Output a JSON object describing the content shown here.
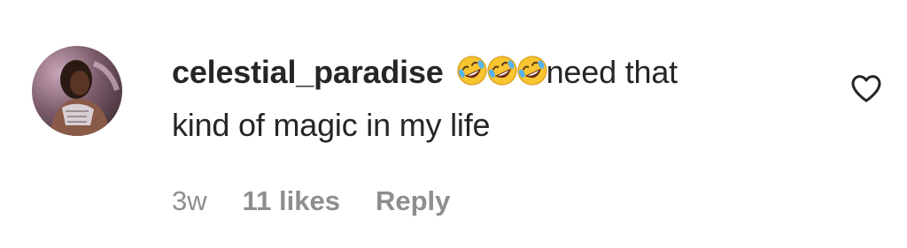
{
  "comment": {
    "avatar_icon": "user-avatar-photo",
    "username": "celestial_paradise",
    "emojis": [
      "rolling-on-floor-laughing-emoji",
      "rolling-on-floor-laughing-emoji",
      "rolling-on-floor-laughing-emoji"
    ],
    "text_part1": "need that",
    "text_part2": "kind of magic in my life",
    "time": "3w",
    "likes": "11 likes",
    "reply": "Reply",
    "like_icon": "heart-outline-icon"
  },
  "colors": {
    "text": "#262626",
    "meta": "#8e8e8e",
    "background": "#ffffff"
  }
}
